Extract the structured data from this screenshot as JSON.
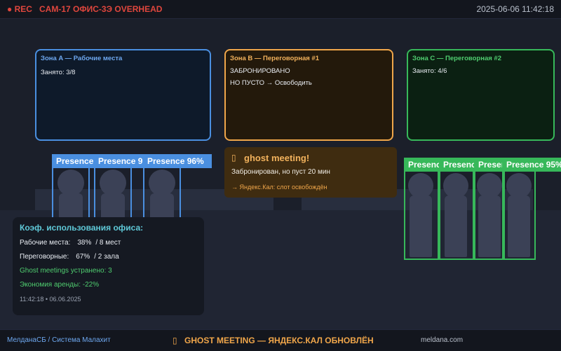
{
  "topbar": {
    "rec": "● REC",
    "camera": "CAM-17 ОФИС-3Э OVERHEAD",
    "datetime": "2025-06-06  11:42:18"
  },
  "zones": {
    "a": {
      "title": "Зона A — Рабочие места",
      "line1": "Занято: 3/8"
    },
    "b": {
      "title": "Зона B — Переговорная #1",
      "line1": "ЗАБРОНИРОВАНО",
      "line2": "НО ПУСТО → Освободить"
    },
    "c": {
      "title": "Зона C — Переговорная #2",
      "line1": "Занято: 4/6"
    }
  },
  "detections": {
    "blue": [
      {
        "label": "Presence 9"
      },
      {
        "label": "Presence 9"
      },
      {
        "label": "Presence 96%"
      }
    ],
    "green": [
      {
        "label": "Presence"
      },
      {
        "label": "Presence"
      },
      {
        "label": "Presence"
      },
      {
        "label": "Presence 95%"
      }
    ]
  },
  "ghost": {
    "icon": "warning-icon",
    "icon_glyph": "▯",
    "title": "ghost meeting!",
    "subtitle": "Забронирован, но пуст 20 мин",
    "action": "→ Яндекс.Кал: слот освобождён"
  },
  "stats": {
    "title": "Коэф. использования офиса:",
    "workplaces": {
      "label": "Рабочие места:",
      "percent": "38%",
      "detail": "/ 8 мест"
    },
    "meeting_rooms": {
      "label": "Переговорные:",
      "percent": "67%",
      "detail": "/ 2 зала"
    },
    "ghost_fixed": "Ghost meetings устранено: 3",
    "savings": "Экономия аренды:  -22%",
    "timestamp": "11:42:18  •  06.06.2025"
  },
  "bottombar": {
    "brand": "МелданаСБ / Система Малахит",
    "ticker_icon_glyph": "▯",
    "ticker": "GHOST MEETING — ЯНДЕКС.КАЛ ОБНОВЛЁН",
    "site": "meldana.com"
  },
  "colors": {
    "zone_a": "#4a8fe0",
    "zone_b": "#f0a64a",
    "zone_c": "#37b85a",
    "alert_red": "#e0463d"
  }
}
